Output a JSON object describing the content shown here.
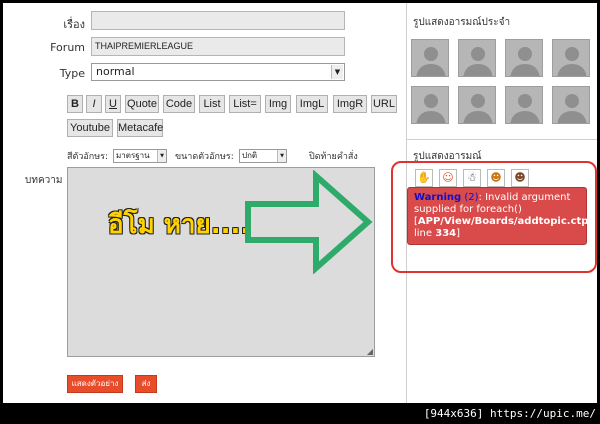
{
  "form": {
    "subject_label": "เรื่อง",
    "subject_value": "",
    "forum_label": "Forum",
    "forum_value": "THAIPREMIERLEAGUE",
    "type_label": "Type",
    "type_value": "normal",
    "content_label": "บทความ"
  },
  "toolbar": {
    "buttons": [
      "B",
      "I",
      "U",
      "Quote",
      "Code",
      "List",
      "List=",
      "Img",
      "ImgL",
      "ImgR",
      "URL",
      "Youtube",
      "Metacafe"
    ]
  },
  "format": {
    "font_color_label": "สีตัวอักษร:",
    "font_color_value": "มาตรฐาน",
    "font_size_label": "ขนาดตัวอักษร:",
    "font_size_value": "ปกติ",
    "close_tags_label": "ปิดท้ายคำสั่ง"
  },
  "editor": {
    "overlay_text": "อีโม หาย....",
    "arrow_color": "#2eaa6a",
    "text_color": "#ffd200"
  },
  "sidebar": {
    "regular_heading": "รูปแสดงอารมณ์ประจำ",
    "emotion_heading": "รูปแสดงอารมณ์",
    "highlight_color": "#e0332f"
  },
  "warning": {
    "title": "Warning",
    "code": "(2)",
    "message": ": Invalid argument supplied for foreach()",
    "path": "APP/View/Boards/addtopic.ctp",
    "line_text": ", line ",
    "line_number": "334",
    "bg_color": "#d94a4a"
  },
  "actions": {
    "preview_label": "แสดงตัวอย่าง",
    "submit_label": "ส่ง"
  },
  "watermark": "[944x636] https://upic.me/"
}
